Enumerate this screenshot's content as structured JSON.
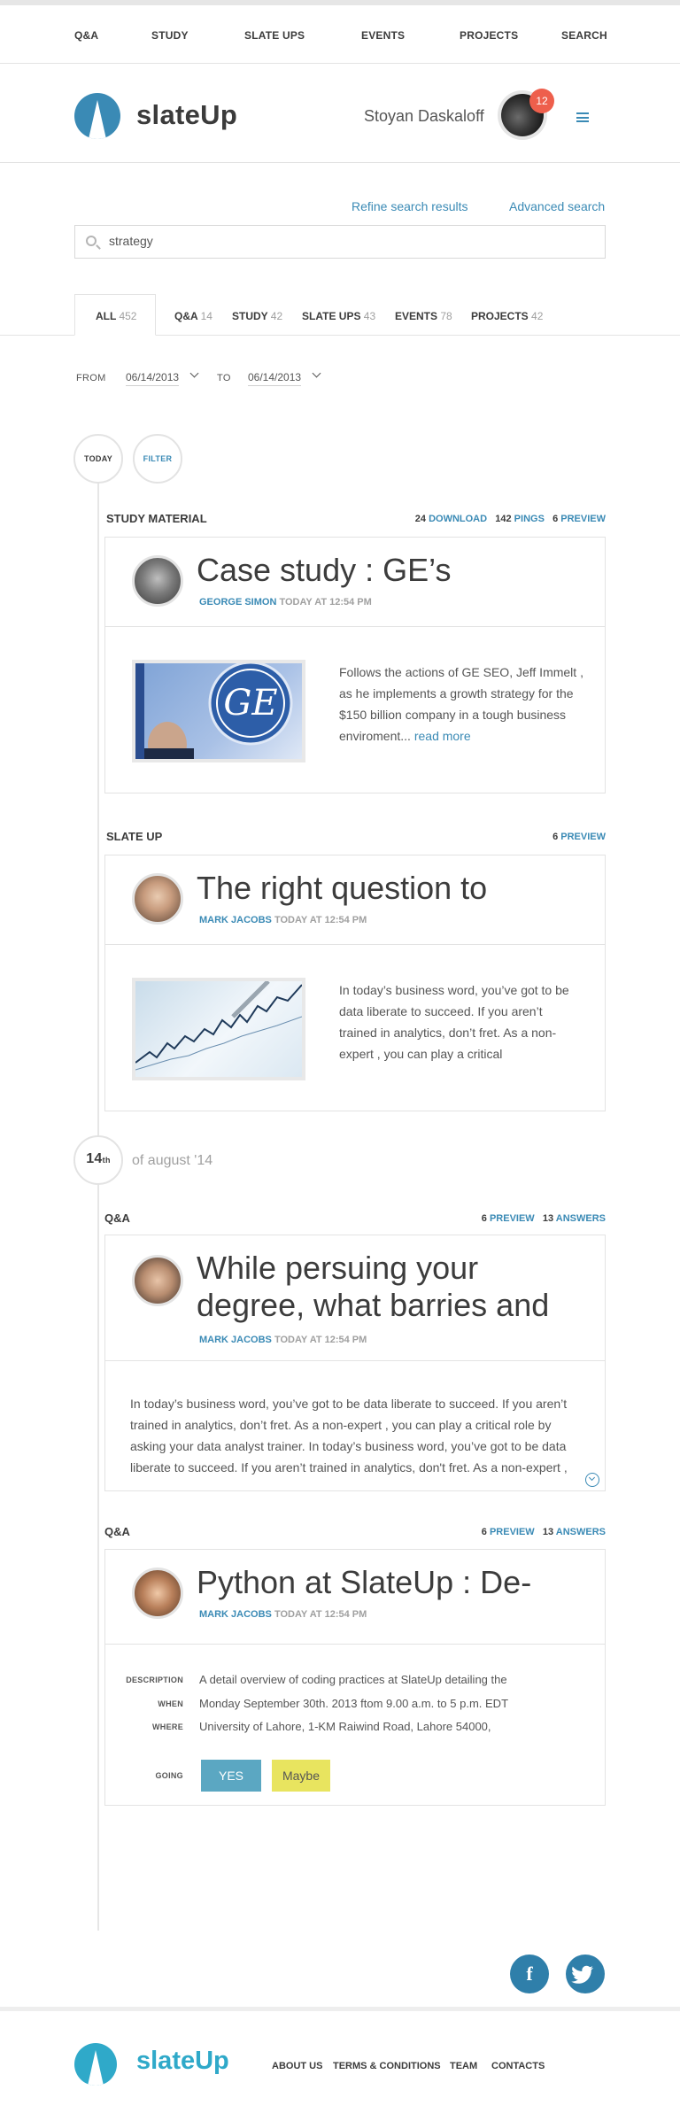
{
  "topnav": [
    "Q&A",
    "STUDY",
    "SLATE UPS",
    "EVENTS",
    "PROJECTS",
    "SEARCH"
  ],
  "header": {
    "logo": "slateUp",
    "user_name": "Stoyan Daskaloff",
    "notifications": "12"
  },
  "search": {
    "refine": "Refine search results",
    "advanced": "Advanced search",
    "query": "strategy"
  },
  "tabs": [
    {
      "label": "ALL",
      "count": "452"
    },
    {
      "label": "Q&A",
      "count": "14"
    },
    {
      "label": "STUDY",
      "count": "42"
    },
    {
      "label": "SLATE UPS",
      "count": "43"
    },
    {
      "label": "EVENTS",
      "count": "78"
    },
    {
      "label": "PROJECTS",
      "count": "42"
    }
  ],
  "date_filter": {
    "from_label": "FROM",
    "from": "06/14/2013",
    "to_label": "TO",
    "to": "06/14/2013"
  },
  "timeline": {
    "today": "TODAY",
    "filter": "FILTER",
    "day_num": "14",
    "day_sup": "th",
    "day_label": "of august '14"
  },
  "items": [
    {
      "section": "STUDY MATERIAL",
      "stats": [
        {
          "num": "24",
          "label": "DOWNLOAD"
        },
        {
          "num": "142",
          "label": "PINGS"
        },
        {
          "num": "6",
          "label": "PREVIEW"
        }
      ],
      "title": "Case study : GE’s",
      "author": "GEORGE SIMON",
      "time": "TODAY AT 12:54 PM",
      "body": "Follows the actions of GE SEO, Jeff Immelt , as he implements a growth strategy for the $150 billion company in a tough business enviroment...",
      "more": "read more"
    },
    {
      "section": "SLATE UP",
      "stats": [
        {
          "num": "6",
          "label": "PREVIEW"
        }
      ],
      "title": "The right question to",
      "author": "MARK JACOBS",
      "time": "TODAY AT 12:54 PM",
      "body": "In today’s business word, you’ve got to be data liberate to succeed. If you aren’t trained in analytics, don’t fret. As a non-expert , you can play a critical"
    },
    {
      "section": "Q&A",
      "stats": [
        {
          "num": "6",
          "label": "PREVIEW"
        },
        {
          "num": "13",
          "label": "ANSWERS"
        }
      ],
      "title": "While persuing your degree, what barries and",
      "author": "MARK JACOBS",
      "time": "TODAY AT 12:54 PM",
      "body": "In today’s business word, you’ve got to be data liberate to succeed. If you aren’t trained in analytics, don’t fret. As a non-expert , you can play a critical role by asking your data analyst trainer. In today’s business word, you’ve got to be data liberate to succeed. If you aren’t trained in analytics, don't fret. As a non-expert ,"
    },
    {
      "section": "Q&A",
      "stats": [
        {
          "num": "6",
          "label": "PREVIEW"
        },
        {
          "num": "13",
          "label": "ANSWERS"
        }
      ],
      "title": "Python at SlateUp : De-",
      "author": "MARK JACOBS",
      "time": "TODAY AT 12:54 PM",
      "event": {
        "description_label": "DESCRIPTION",
        "description": "A detail overview of coding practices at SlateUp detailing the",
        "when_label": "WHEN",
        "when": "Monday September 30th. 2013 ftom 9.00 a.m. to 5 p.m. EDT",
        "where_label": "WHERE",
        "where": "University of Lahore, 1-KM Raiwind Road, Lahore 54000,",
        "going_label": "GOING",
        "yes": "YES",
        "maybe": "Maybe"
      }
    }
  ],
  "social": {
    "facebook": "f",
    "twitter": "t"
  },
  "footer": {
    "logo": "slateUp",
    "links": [
      "ABOUT US",
      "TERMS & CONDITIONS",
      "TEAM",
      "CONTACTS"
    ]
  },
  "colors": {
    "accent": "#3a8ab5",
    "badge": "#ee5f4c",
    "yes": "#5ba7c2",
    "maybe": "#e8e45f"
  }
}
